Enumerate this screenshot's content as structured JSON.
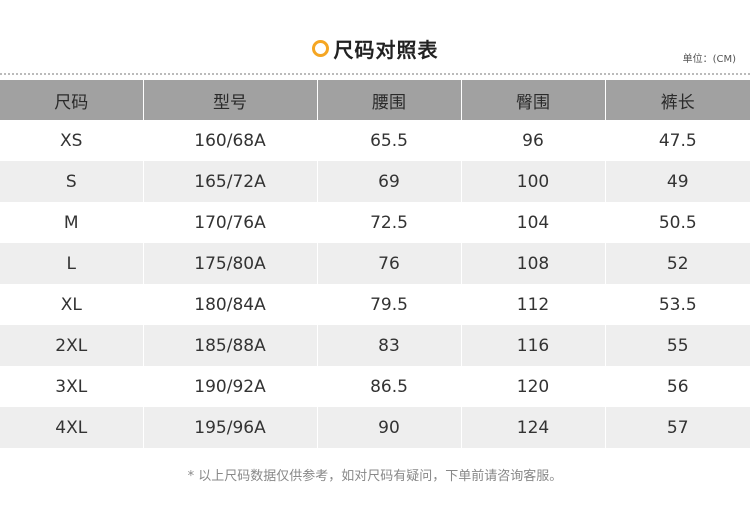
{
  "header": {
    "title": "尺码对照表",
    "unit": "单位：(CM)"
  },
  "table": {
    "columns": [
      "尺码",
      "型号",
      "腰围",
      "臀围",
      "裤长"
    ],
    "rows": [
      [
        "XS",
        "160/68A",
        "65.5",
        "96",
        "47.5"
      ],
      [
        "S",
        "165/72A",
        "69",
        "100",
        "49"
      ],
      [
        "M",
        "170/76A",
        "72.5",
        "104",
        "50.5"
      ],
      [
        "L",
        "175/80A",
        "76",
        "108",
        "52"
      ],
      [
        "XL",
        "180/84A",
        "79.5",
        "112",
        "53.5"
      ],
      [
        "2XL",
        "185/88A",
        "83",
        "116",
        "55"
      ],
      [
        "3XL",
        "190/92A",
        "86.5",
        "120",
        "56"
      ],
      [
        "4XL",
        "195/96A",
        "90",
        "124",
        "57"
      ]
    ]
  },
  "footnote": "* 以上尺码数据仅供参考，如对尺码有疑问，下单前请咨询客服。",
  "colors": {
    "accent": "#f5a623",
    "header_bg": "#a1a1a1",
    "row_alt_bg": "#eeeeee"
  },
  "icons": {
    "title_icon": "circle-icon"
  }
}
